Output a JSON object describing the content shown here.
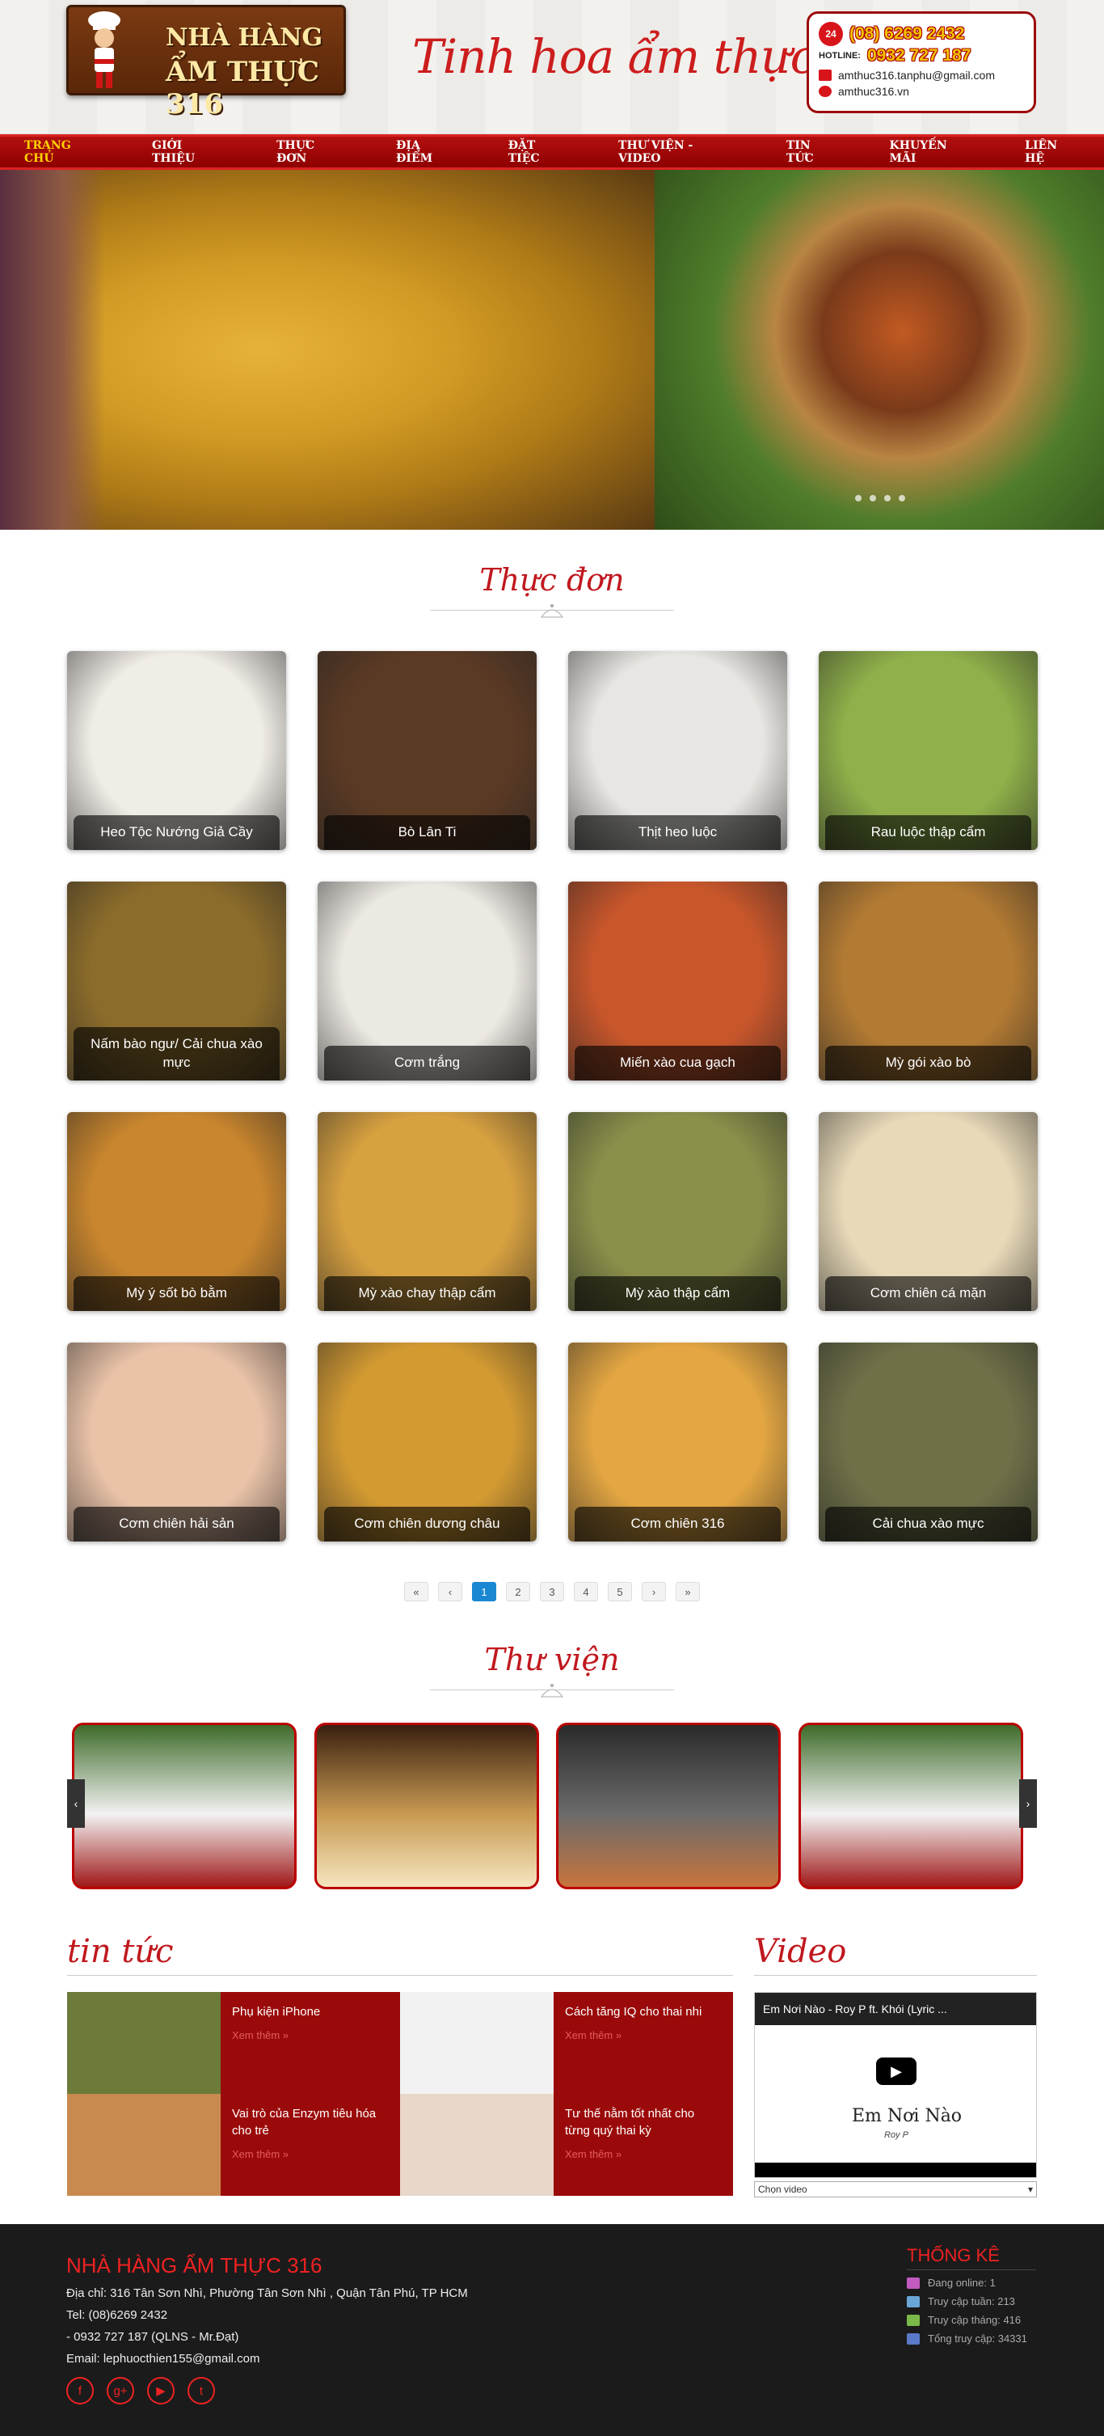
{
  "header": {
    "logo_line1": "NHÀ HÀNG",
    "logo_line2": "ẨM THỰC 316",
    "slogan": "Tinh hoa ẩm thực việt",
    "hotline_label": "HOTLINE:",
    "phone1": "(08) 6269 2432",
    "phone2": "0932 727 187",
    "email": "amthuc316.tanphu@gmail.com",
    "website": "amthuc316.vn",
    "icon_24": "24"
  },
  "nav": [
    "TRANG CHỦ",
    "GIỚI THIỆU",
    "THỰC ĐƠN",
    "ĐỊA ĐIỂM",
    "ĐẶT TIỆC",
    "THƯ VIỆN - VIDEO",
    "TIN TỨC",
    "KHUYẾN MÃI",
    "LIÊN HỆ"
  ],
  "menu_section": {
    "title": "Thực đơn",
    "items": [
      {
        "name": "Heo Tộc Nướng Giả Cầy",
        "color": "#f0ece6"
      },
      {
        "name": "Bò Lân Ti",
        "color": "#5b3a24"
      },
      {
        "name": "Thịt heo luộc",
        "color": "#e8e6e2"
      },
      {
        "name": "Rau luộc thập cẩm",
        "color": "#8fb04a"
      },
      {
        "name": "Nấm bào ngư/ Cải chua xào mực",
        "color": "#8c6c2b"
      },
      {
        "name": "Cơm trắng",
        "color": "#ece8e2"
      },
      {
        "name": "Miến xào cua gạch",
        "color": "#c8562b"
      },
      {
        "name": "Mỳ gói xào bò",
        "color": "#b27a33"
      },
      {
        "name": "Mỳ ý sốt bò bằm",
        "color": "#c9862e"
      },
      {
        "name": "Mỳ xào chay thập cẩm",
        "color": "#d8a140"
      },
      {
        "name": "Mỳ xào thập cẩm",
        "color": "#8a8f4a"
      },
      {
        "name": "Cơm chiên cá mặn",
        "color": "#e8d9b8"
      },
      {
        "name": "Cơm chiên hải sản",
        "color": "#e9c2a8"
      },
      {
        "name": "Cơm chiên dương châu",
        "color": "#d39a32"
      },
      {
        "name": "Cơm chiên 316",
        "color": "#e3a642"
      },
      {
        "name": "Cải chua xào mực",
        "color": "#6f7048"
      }
    ],
    "pager": [
      "«",
      "‹",
      "1",
      "2",
      "3",
      "4",
      "5",
      "›",
      "»"
    ]
  },
  "library": {
    "title": "Thư viện",
    "items": [
      {
        "colors": [
          "#3e6b2a",
          "#f2f2f2",
          "#a01818"
        ]
      },
      {
        "colors": [
          "#3a1f10",
          "#c89a52",
          "#f5e5c0"
        ]
      },
      {
        "colors": [
          "#2a2a2a",
          "#6b6b6b",
          "#c8743c"
        ]
      },
      {
        "colors": [
          "#3e6b2a",
          "#f2f2f2",
          "#a01818"
        ]
      }
    ],
    "prev": "‹",
    "next": "›"
  },
  "news": {
    "title": "tin tức",
    "items": [
      {
        "title": "Phụ kiện iPhone",
        "more": "Xem thêm »",
        "color": "#6c7a3a"
      },
      {
        "title": "Cách tăng IQ cho thai nhi",
        "more": "Xem thêm »",
        "color": "#f2f2f2"
      },
      {
        "title": "Vai trò của Enzym tiêu hóa cho trẻ",
        "more": "Xem thêm »",
        "color": "#c98a4f"
      },
      {
        "title": "Tư thế nằm tốt nhất cho từng quý thai kỳ",
        "more": "Xem thêm »",
        "color": "#e9d7c9"
      }
    ]
  },
  "video": {
    "title": "Video",
    "caption": "Em Nơi Nào - Roy P ft. Khói (Lyric ...",
    "inner_title": "Em Nơi Nào",
    "inner_sub": "Roy P",
    "select": "Chọn video"
  },
  "footer": {
    "name": "NHÀ HÀNG ẨM THỰC 316",
    "address": "Địa chỉ: 316 Tân Sơn Nhì, Phường Tân Sơn Nhì , Quận Tân Phú, TP HCM",
    "tel": "Tel: (08)6269 2432",
    "tel2": " - 0932 727 187 (QLNS - Mr.Đạt)",
    "email": "Email: lephuocthien155@gmail.com",
    "social": [
      "f",
      "g+",
      "▶",
      "t"
    ],
    "stats_title": "THỐNG KÊ",
    "stats": [
      {
        "label": "Đang online: 1",
        "color": "#c25abf"
      },
      {
        "label": "Truy cập tuần: 213",
        "color": "#6aa7d7"
      },
      {
        "label": "Truy cập tháng: 416",
        "color": "#7bb84a"
      },
      {
        "label": "Tổng truy cập: 34331",
        "color": "#5a79c9"
      }
    ]
  }
}
